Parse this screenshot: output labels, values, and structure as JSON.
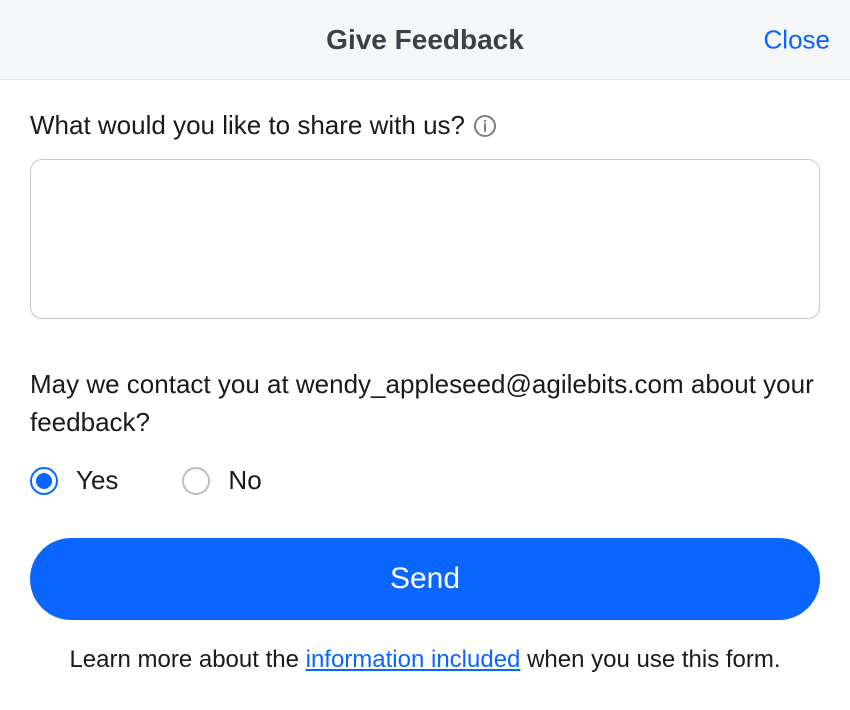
{
  "header": {
    "title": "Give Feedback",
    "close_label": "Close"
  },
  "form": {
    "share_prompt": "What would you like to share with us?",
    "textarea_value": "",
    "contact_prompt": "May we contact you at wendy_appleseed@agilebits.com about your feedback?",
    "radio": {
      "yes_label": "Yes",
      "no_label": "No",
      "selected": "yes"
    },
    "send_label": "Send"
  },
  "footer": {
    "prefix": "Learn more about the ",
    "link_text": "information included",
    "suffix": " when you use this form."
  }
}
